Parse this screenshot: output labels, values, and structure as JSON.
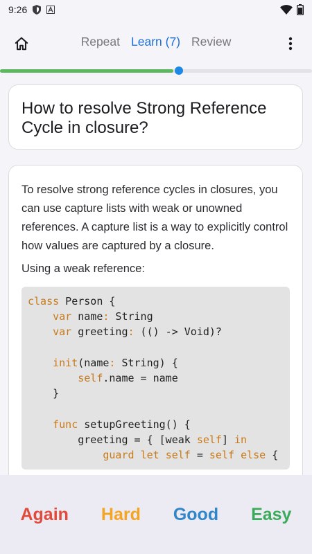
{
  "status_bar": {
    "time": "9:26",
    "icons": [
      "shield-icon",
      "a-icon",
      "wifi-icon",
      "battery-icon"
    ]
  },
  "top_bar": {
    "home_icon": "home-icon",
    "tabs": [
      {
        "label": "Repeat",
        "active": false
      },
      {
        "label": "Learn (7)",
        "active": true
      },
      {
        "label": "Review",
        "active": false
      }
    ],
    "menu_icon": "more-vert-icon"
  },
  "progress": {
    "fraction": 0.555,
    "fill_color": "#5cb85c",
    "knob_color": "#1e88e5"
  },
  "question": {
    "text": "How to resolve Strong Reference Cycle in closure?"
  },
  "answer": {
    "paragraph1": "To resolve strong reference cycles in closures, you can use capture lists with weak or unowned references. A capture list is a way to explicitly control how values are captured by a closure.",
    "paragraph2": "Using a weak reference:",
    "code_lines": [
      [
        [
          "kw",
          "class"
        ],
        [
          "t",
          " Person {"
        ]
      ],
      [
        [
          "t",
          "    "
        ],
        [
          "kw",
          "var"
        ],
        [
          "t",
          " name"
        ],
        [
          "kw",
          ":"
        ],
        [
          "t",
          " String"
        ]
      ],
      [
        [
          "t",
          "    "
        ],
        [
          "kw",
          "var"
        ],
        [
          "t",
          " greeting"
        ],
        [
          "kw",
          ":"
        ],
        [
          "t",
          " (() -> Void)?"
        ]
      ],
      [
        [
          "t",
          ""
        ]
      ],
      [
        [
          "t",
          "    "
        ],
        [
          "kw",
          "init"
        ],
        [
          "t",
          "(name"
        ],
        [
          "kw",
          ":"
        ],
        [
          "t",
          " String) {"
        ]
      ],
      [
        [
          "t",
          "        "
        ],
        [
          "kw",
          "self"
        ],
        [
          "t",
          ".name = name"
        ]
      ],
      [
        [
          "t",
          "    }"
        ]
      ],
      [
        [
          "t",
          ""
        ]
      ],
      [
        [
          "t",
          "    "
        ],
        [
          "kw",
          "func"
        ],
        [
          "t",
          " setupGreeting() {"
        ]
      ],
      [
        [
          "t",
          "        greeting = { [weak "
        ],
        [
          "kw",
          "self"
        ],
        [
          "t",
          "] "
        ],
        [
          "kw",
          "in"
        ]
      ],
      [
        [
          "t",
          "            "
        ],
        [
          "kw",
          "guard"
        ],
        [
          "t",
          " "
        ],
        [
          "kw",
          "let"
        ],
        [
          "t",
          " "
        ],
        [
          "kw",
          "self"
        ],
        [
          "t",
          " = "
        ],
        [
          "kw",
          "self"
        ],
        [
          "t",
          " "
        ],
        [
          "kw",
          "else"
        ],
        [
          "t",
          " {"
        ]
      ]
    ]
  },
  "answer_buttons": [
    {
      "label": "Again",
      "color": "#e04b3c"
    },
    {
      "label": "Hard",
      "color": "#f5a524"
    },
    {
      "label": "Good",
      "color": "#2f86c8"
    },
    {
      "label": "Easy",
      "color": "#3aab5a"
    }
  ]
}
